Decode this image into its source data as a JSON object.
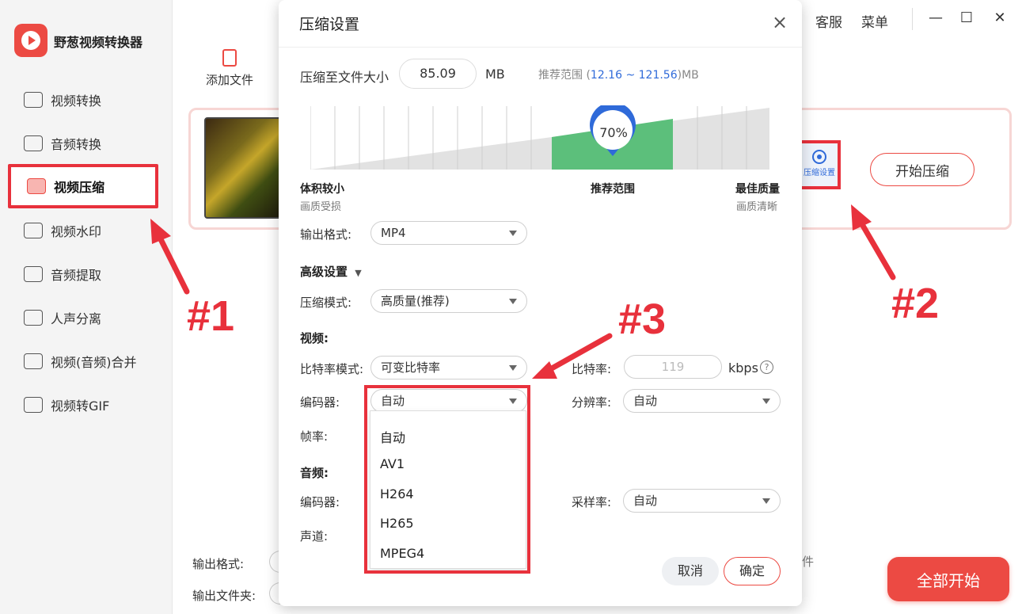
{
  "app": {
    "title": "野葱视频转换器",
    "brand_color": "#ec4a43",
    "logo_icon": "play-icon"
  },
  "sidebar": {
    "items": [
      {
        "label": "视频转换",
        "icon": "video-convert-icon"
      },
      {
        "label": "音频转换",
        "icon": "audio-convert-icon"
      },
      {
        "label": "视频压缩",
        "icon": "video-compress-icon",
        "active": true
      },
      {
        "label": "视频水印",
        "icon": "watermark-icon"
      },
      {
        "label": "音频提取",
        "icon": "audio-extract-icon"
      },
      {
        "label": "人声分离",
        "icon": "voice-separate-icon"
      },
      {
        "label": "视频(音频)合并",
        "icon": "merge-icon"
      },
      {
        "label": "视频转GIF",
        "icon": "gif-icon"
      }
    ]
  },
  "toolbar": {
    "add_file": "添加文件",
    "service": "客服",
    "menu": "菜单",
    "minimize": "—",
    "maximize": "☐",
    "close": "✕"
  },
  "file_card": {
    "settings_label": "压缩设置",
    "start_label": "开始压缩"
  },
  "bottom": {
    "output_format_label": "输出格式:",
    "output_folder_label": "输出文件夹:",
    "tail_text": "件",
    "start_all": "全部开始"
  },
  "dialog": {
    "title": "压缩设置",
    "size_label": "压缩至文件大小",
    "size_value": "85.09",
    "size_unit": "MB",
    "range_prefix": "推荐范围 (",
    "range_values": "12.16 ~ 121.56",
    "range_suffix": ")MB",
    "slider": {
      "percent_label": "70%",
      "value_percent": 70,
      "left_title": "体积较小",
      "left_sub": "画质受损",
      "mid_title": "推荐范围",
      "right_title": "最佳质量",
      "right_sub": "画质清晰"
    },
    "output_format_label": "输出格式:",
    "output_format_value": "MP4",
    "advanced_label": "高级设置",
    "compress_mode_label": "压缩模式:",
    "compress_mode_value": "高质量(推荐)",
    "video_section": "视频:",
    "bitrate_mode_label": "比特率模式:",
    "bitrate_mode_value": "可变比特率",
    "bitrate_label": "比特率:",
    "bitrate_value": "119",
    "bitrate_unit": "kbps",
    "encoder_label": "编码器:",
    "encoder_value": "自动",
    "resolution_label": "分辨率:",
    "resolution_value": "自动",
    "framerate_label": "帧率:",
    "audio_section": "音频:",
    "audio_encoder_label": "编码器:",
    "samplerate_label": "采样率:",
    "samplerate_value": "自动",
    "channel_label": "声道:",
    "encoder_options": [
      "自动",
      "AV1",
      "H264",
      "H265",
      "MPEG4"
    ],
    "cancel": "取消",
    "ok": "确定"
  },
  "annotations": {
    "note1": "#1",
    "note2": "#2",
    "note3": "#3",
    "color": "#e8313c"
  }
}
